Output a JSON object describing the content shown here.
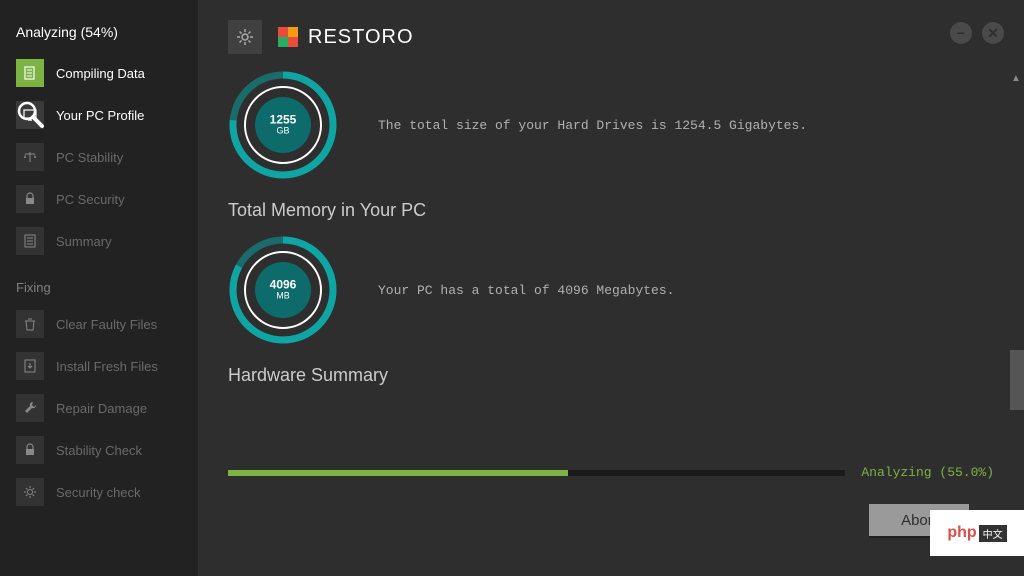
{
  "sidebar": {
    "header": "Analyzing (54%)",
    "analyzing": {
      "items": [
        {
          "label": "Compiling Data",
          "state": "active"
        },
        {
          "label": "Your PC Profile",
          "state": "current"
        },
        {
          "label": "PC Stability",
          "state": "inactive"
        },
        {
          "label": "PC Security",
          "state": "inactive"
        },
        {
          "label": "Summary",
          "state": "inactive"
        }
      ]
    },
    "fixing": {
      "label": "Fixing",
      "items": [
        {
          "label": "Clear Faulty Files"
        },
        {
          "label": "Install Fresh Files"
        },
        {
          "label": "Repair Damage"
        },
        {
          "label": "Stability Check"
        },
        {
          "label": "Security check"
        }
      ]
    }
  },
  "brand": {
    "name": "RESTORO"
  },
  "gauges": {
    "disk": {
      "value": "1255",
      "unit": "GB",
      "desc": "The total size of your Hard Drives is 1254.5 Gigabytes."
    },
    "memory_title": "Total Memory in Your PC",
    "memory": {
      "value": "4096",
      "unit": "MB",
      "desc": "Your PC has a total of 4096 Megabytes."
    },
    "hardware_title": "Hardware Summary"
  },
  "progress": {
    "label": "Analyzing  (55.0%)",
    "percent": 55
  },
  "buttons": {
    "abort": "Abort"
  },
  "colors": {
    "accent": "#7cb342",
    "teal": "#0d7e7e"
  },
  "badge": {
    "php": "php"
  }
}
